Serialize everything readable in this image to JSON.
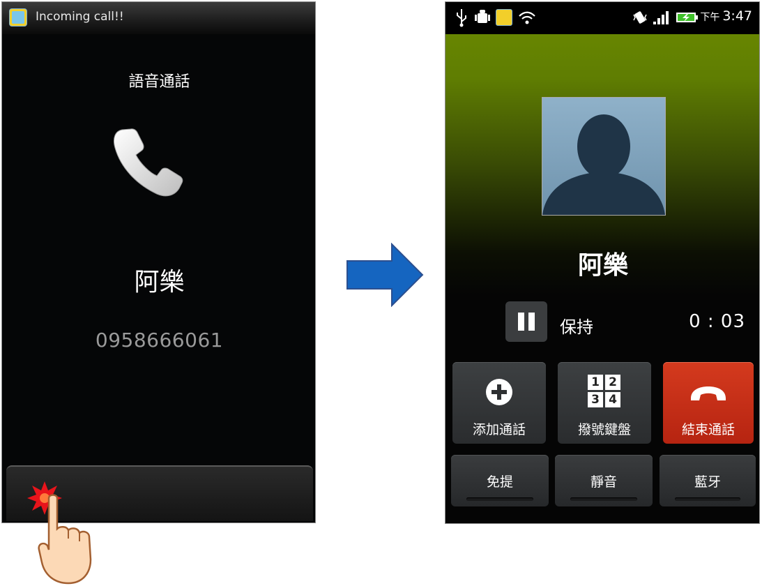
{
  "incoming_screen": {
    "status_title": "Incoming call!!",
    "call_type": "語音通話",
    "caller_name": "阿樂",
    "caller_number": "0958666061",
    "icons": [
      "app-icon",
      "handset-icon",
      "tap-burst-icon",
      "finger-hand-icon"
    ]
  },
  "transition": {
    "icon": "right-arrow-icon",
    "color": "#1565c0"
  },
  "active_screen": {
    "status_bar": {
      "icons": [
        "usb-icon",
        "android-debug-icon",
        "app-icon",
        "wifi-icon",
        "vibrate-icon",
        "signal-icon",
        "battery-charging-icon"
      ],
      "time_prefix": "下午",
      "time": "3:47"
    },
    "caller_name": "阿樂",
    "hold_label": "保持",
    "timer": "0 : 03",
    "actions": [
      {
        "label": "添加通話",
        "icon": "add-call-icon"
      },
      {
        "label": "撥號鍵盤",
        "icon": "dialpad-icon",
        "keys": [
          "1",
          "2",
          "3",
          "4"
        ]
      },
      {
        "label": "結束通話",
        "icon": "end-call-icon",
        "color": "#c62d16"
      }
    ],
    "toggles": [
      {
        "label": "免提"
      },
      {
        "label": "靜音"
      },
      {
        "label": "藍牙"
      }
    ]
  }
}
